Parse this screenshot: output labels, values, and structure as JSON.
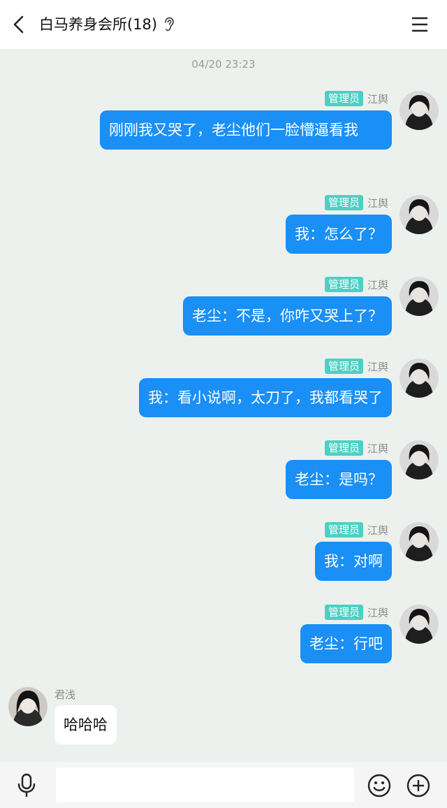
{
  "header": {
    "title": "白马养身会所(18)",
    "back_icon": "chevron-left-icon",
    "ear_icon": "ear-icon",
    "menu_icon": "hamburger-menu-icon"
  },
  "chat": {
    "timestamp": "04/20 23:23",
    "messages": [
      {
        "side": "right",
        "badge": "管理员",
        "sender": "江舆",
        "text": "刚刚我又哭了，老尘他们一脸懵逼看我"
      },
      {
        "side": "right",
        "badge": "管理员",
        "sender": "江舆",
        "text": "我：怎么了？"
      },
      {
        "side": "right",
        "badge": "管理员",
        "sender": "江舆",
        "text": "老尘：不是，你咋又哭上了？"
      },
      {
        "side": "right",
        "badge": "管理员",
        "sender": "江舆",
        "text": "我：看小说啊，太刀了，我都看哭了"
      },
      {
        "side": "right",
        "badge": "管理员",
        "sender": "江舆",
        "text": "老尘：是吗？"
      },
      {
        "side": "right",
        "badge": "管理员",
        "sender": "江舆",
        "text": "我：对啊"
      },
      {
        "side": "right",
        "badge": "管理员",
        "sender": "江舆",
        "text": "老尘：行吧"
      },
      {
        "side": "left",
        "sender": "君浅",
        "text": "哈哈哈"
      }
    ]
  },
  "input_bar": {
    "mic_icon": "microphone-icon",
    "input_value": "",
    "emoji_icon": "emoji-icon",
    "plus_icon": "plus-circle-icon"
  },
  "colors": {
    "chat_background": "#edf1ee",
    "outgoing_bubble": "#1a8ff5",
    "admin_badge": "#4dd0c4"
  }
}
